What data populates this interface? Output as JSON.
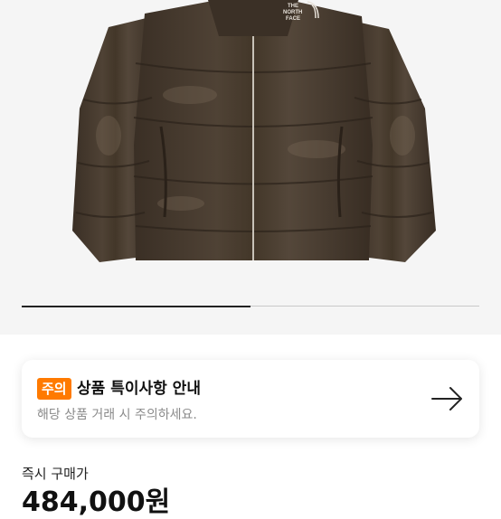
{
  "product": {
    "image_alt": "brown puffer down jacket",
    "logo_text": [
      "THE",
      "NORTH",
      "FACE"
    ]
  },
  "image_indicator": {
    "current_fraction": 0.5
  },
  "notice": {
    "badge": "주의",
    "title": "상품 특이사항 안내",
    "description": "해당 상품 거래 시 주의하세요.",
    "action_icon": "arrow-right-icon"
  },
  "purchase": {
    "label": "즉시 구매가",
    "price": "484,000원"
  },
  "colors": {
    "badge": "#ff7a00",
    "jacket": "#4a3d30"
  }
}
